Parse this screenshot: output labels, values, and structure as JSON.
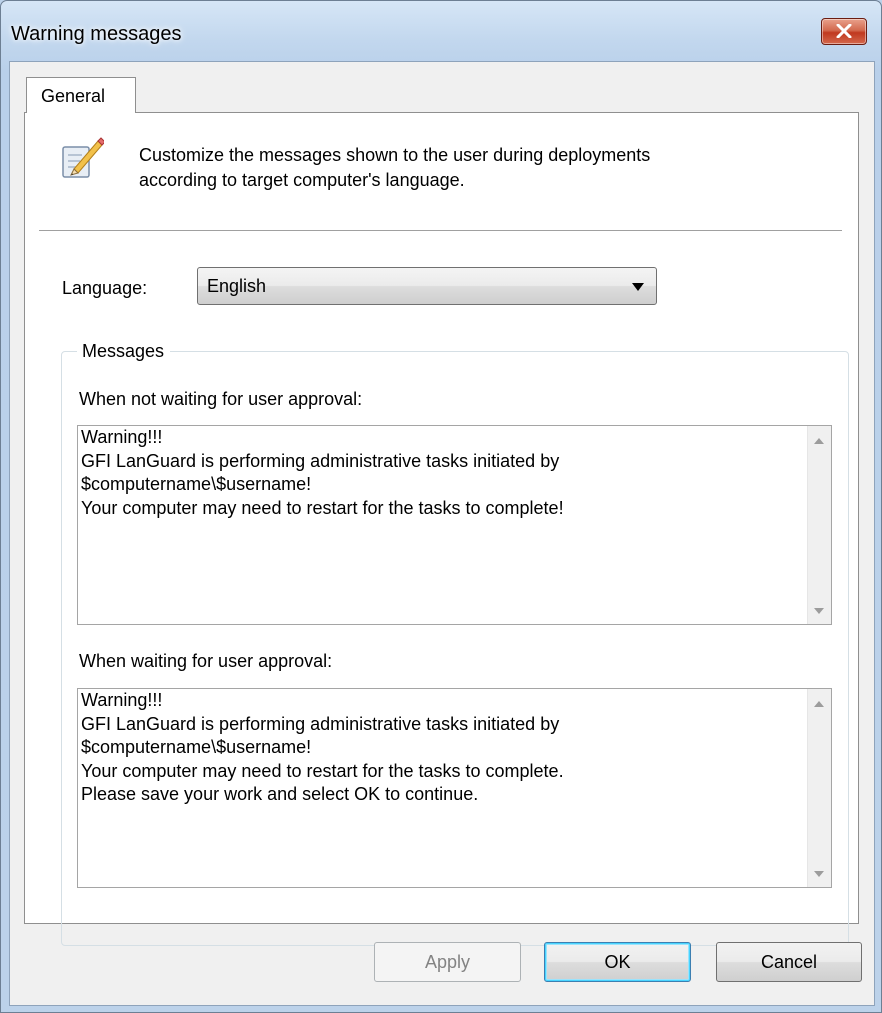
{
  "window": {
    "title": "Warning messages"
  },
  "tabs": [
    {
      "label": "General"
    }
  ],
  "header": {
    "icon": "pencil-edit-icon",
    "description_line1": "Customize the messages shown to the user during deployments",
    "description_line2": "according to target computer's language."
  },
  "language": {
    "label": "Language:",
    "selected": "English"
  },
  "messages": {
    "group_title": "Messages",
    "not_waiting": {
      "label": "When not waiting for user approval:",
      "text": "Warning!!!\nGFI LanGuard is performing administrative tasks initiated by\n$computername\\$username!\nYour computer may need to restart for the tasks to complete!"
    },
    "waiting": {
      "label": "When waiting for user approval:",
      "text": "Warning!!!\nGFI LanGuard is performing administrative tasks initiated by\n$computername\\$username!\nYour computer may need to restart for the tasks to complete.\nPlease save your work and select OK to continue."
    }
  },
  "buttons": {
    "apply": "Apply",
    "ok": "OK",
    "cancel": "Cancel"
  },
  "colors": {
    "title_bar": "#c2d7ee",
    "close_button": "#c0391f",
    "default_button_border": "#3c7fb1"
  }
}
